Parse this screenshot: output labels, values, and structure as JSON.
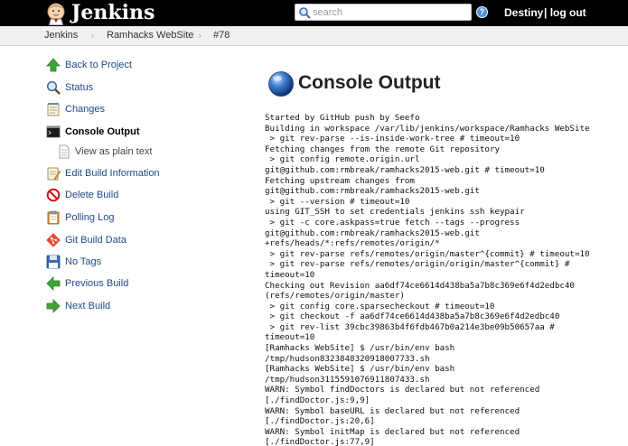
{
  "header": {
    "brand": "Jenkins",
    "search_placeholder": "search",
    "help": "?",
    "user": "Destiny",
    "logout": "| log out"
  },
  "breadcrumb": {
    "items": [
      "Jenkins",
      "Ramhacks WebSite",
      "#78"
    ],
    "separator": "›"
  },
  "sidebar": {
    "items": [
      {
        "label": "Back to Project",
        "icon": "up-arrow-icon"
      },
      {
        "label": "Status",
        "icon": "magnifier-icon"
      },
      {
        "label": "Changes",
        "icon": "notepad-icon"
      },
      {
        "label": "Console Output",
        "icon": "terminal-icon"
      },
      {
        "label": "View as plain text",
        "icon": "document-icon"
      },
      {
        "label": "Edit Build Information",
        "icon": "notepad-pencil-icon"
      },
      {
        "label": "Delete Build",
        "icon": "no-entry-icon"
      },
      {
        "label": "Polling Log",
        "icon": "clipboard-icon"
      },
      {
        "label": "Git Build Data",
        "icon": "git-icon"
      },
      {
        "label": "No Tags",
        "icon": "save-disk-icon"
      },
      {
        "label": "Previous Build",
        "icon": "left-arrow-icon"
      },
      {
        "label": "Next Build",
        "icon": "right-arrow-icon"
      }
    ]
  },
  "main": {
    "title": "Console Output",
    "console_lines": [
      "Started by GitHub push by Seefo",
      "Building in workspace /var/lib/jenkins/workspace/Ramhacks WebSite",
      " > git rev-parse --is-inside-work-tree # timeout=10",
      "Fetching changes from the remote Git repository",
      " > git config remote.origin.url",
      "git@github.com:rmbreak/ramhacks2015-web.git # timeout=10",
      "Fetching upstream changes from",
      "git@github.com:rmbreak/ramhacks2015-web.git",
      " > git --version # timeout=10",
      "using GIT_SSH to set credentials jenkins ssh keypair",
      " > git -c core.askpass=true fetch --tags --progress",
      "git@github.com:rmbreak/ramhacks2015-web.git",
      "+refs/heads/*:refs/remotes/origin/*",
      " > git rev-parse refs/remotes/origin/master^{commit} # timeout=10",
      " > git rev-parse refs/remotes/origin/origin/master^{commit} #",
      "timeout=10",
      "Checking out Revision aa6df74ce6614d438ba5a7b8c369e6f4d2edbc40",
      "(refs/remotes/origin/master)",
      " > git config core.sparsecheckout # timeout=10",
      " > git checkout -f aa6df74ce6614d438ba5a7b8c369e6f4d2edbc40",
      " > git rev-list 39cbc39863b4f6fdb467b0a214e3be09b50657aa #",
      "timeout=10",
      "[Ramhacks WebSite] $ /usr/bin/env bash",
      "/tmp/hudson8323848320918007733.sh",
      "[Ramhacks WebSite] $ /usr/bin/env bash",
      "/tmp/hudson3115591076911807433.sh",
      "WARN: Symbol findDoctors is declared but not referenced",
      "[./findDoctor.js:9,9]",
      "WARN: Symbol baseURL is declared but not referenced",
      "[./findDoctor.js:20,6]",
      "WARN: Symbol initMap is declared but not referenced",
      "[./findDoctor.js:77,9]"
    ]
  },
  "colors": {
    "header_bg": "#000000",
    "breadcrumb_bg": "#f0f0f0",
    "link": "#204a87",
    "text": "#111111"
  }
}
